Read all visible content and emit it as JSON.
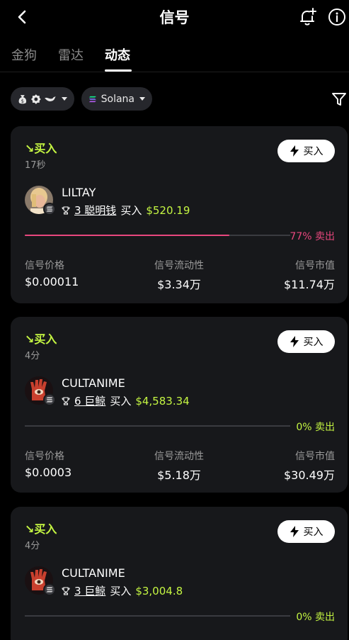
{
  "header": {
    "title": "信号"
  },
  "tabs": [
    {
      "label": "金狗",
      "active": false
    },
    {
      "label": "雷达",
      "active": false
    },
    {
      "label": "动态",
      "active": true
    }
  ],
  "filters": {
    "chain_label": "Solana"
  },
  "colors": {
    "accent_green": "#c4f542",
    "sell_pink": "#e8477e",
    "card_bg": "#17181b"
  },
  "cards": [
    {
      "action": "↘买入",
      "time": "17秒",
      "buy_button": "买入",
      "token": "LILTAY",
      "trade_count": "3 聪明钱",
      "trade_verb": "买入",
      "amount": "$520.19",
      "sell_percent": 77,
      "sell_label": "77% 卖出",
      "stats": {
        "price_label": "信号价格",
        "price": "$0.00011",
        "liquidity_label": "信号流动性",
        "liquidity": "$3.34万",
        "mcap_label": "信号市值",
        "mcap": "$11.74万"
      }
    },
    {
      "action": "↘买入",
      "time": "4分",
      "buy_button": "买入",
      "token": "CULTANIME",
      "trade_count": "6 巨鲸",
      "trade_verb": "买入",
      "amount": "$4,583.34",
      "sell_percent": 0,
      "sell_label": "0% 卖出",
      "stats": {
        "price_label": "信号价格",
        "price": "$0.0003",
        "liquidity_label": "信号流动性",
        "liquidity": "$5.18万",
        "mcap_label": "信号市值",
        "mcap": "$30.49万"
      }
    },
    {
      "action": "↘买入",
      "time": "4分",
      "buy_button": "买入",
      "token": "CULTANIME",
      "trade_count": "3 巨鲸",
      "trade_verb": "买入",
      "amount": "$3,004.8",
      "sell_percent": 0,
      "sell_label": "0% 卖出",
      "stats": {
        "price_label": "信号价格",
        "price": "",
        "liquidity_label": "信号流动性",
        "liquidity": "",
        "mcap_label": "信号市值",
        "mcap": ""
      }
    }
  ]
}
